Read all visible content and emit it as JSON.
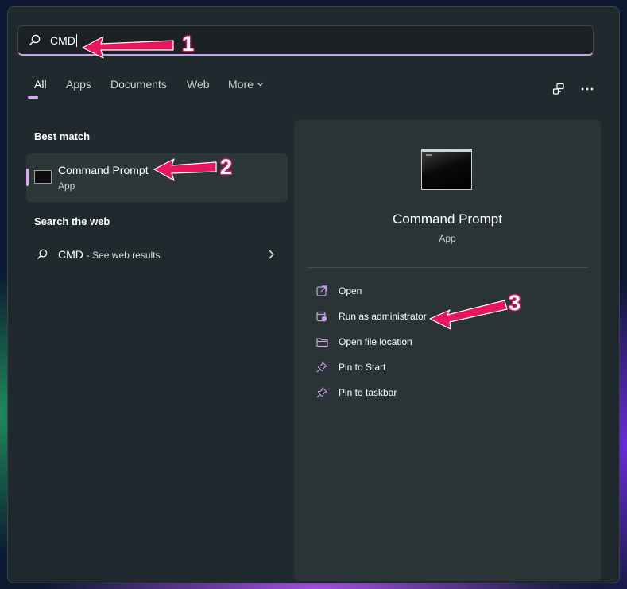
{
  "search": {
    "value": "CMD"
  },
  "tabs": [
    {
      "label": "All",
      "active": true
    },
    {
      "label": "Apps"
    },
    {
      "label": "Documents"
    },
    {
      "label": "Web"
    },
    {
      "label": "More"
    }
  ],
  "top_icons": [
    "share-icon",
    "more-options-icon"
  ],
  "best_match": {
    "section_title": "Best match",
    "title": "Command Prompt",
    "subtitle": "App",
    "icon": "terminal-icon"
  },
  "web": {
    "section_title": "Search the web",
    "query": "CMD",
    "suffix": "- See web results"
  },
  "details": {
    "title": "Command Prompt",
    "subtitle": "App",
    "actions": [
      {
        "label": "Open",
        "icon": "open-external-icon"
      },
      {
        "label": "Run as administrator",
        "icon": "shield-admin-icon"
      },
      {
        "label": "Open file location",
        "icon": "folder-icon"
      },
      {
        "label": "Pin to Start",
        "icon": "pin-icon"
      },
      {
        "label": "Pin to taskbar",
        "icon": "pin-icon"
      }
    ]
  },
  "annotations": [
    {
      "number": "1",
      "color": "#e8175d"
    },
    {
      "number": "2",
      "color": "#e8175d"
    },
    {
      "number": "3",
      "color": "#e8175d"
    }
  ],
  "colors": {
    "accent": "#d9a8f0",
    "panel": "#202a2e",
    "right_pane": "#2a3437",
    "annotation": "#e8175d"
  }
}
